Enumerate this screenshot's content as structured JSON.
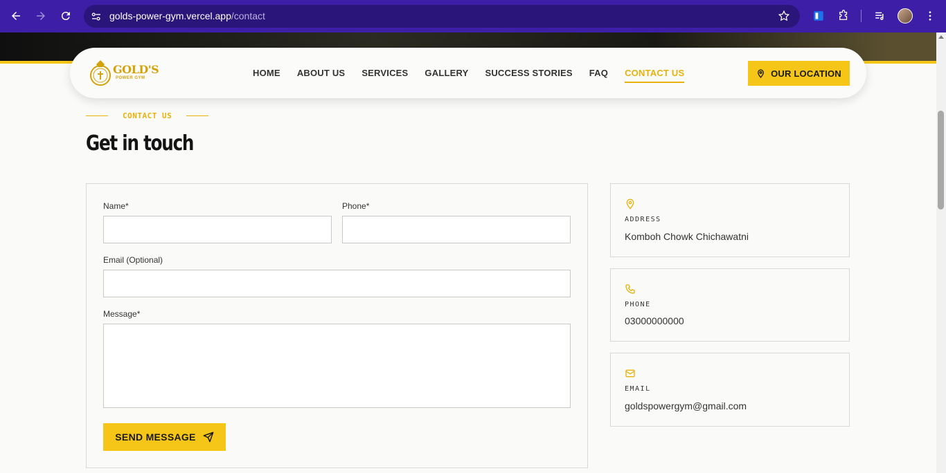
{
  "browser": {
    "url_host": "golds-power-gym.vercel.app",
    "url_path": "/contact"
  },
  "header": {
    "logo_text": "GOLD'S",
    "logo_subtext": "POWER GYM",
    "nav": [
      "HOME",
      "ABOUT US",
      "SERVICES",
      "GALLERY",
      "SUCCESS STORIES",
      "FAQ",
      "CONTACT US"
    ],
    "active_nav": "CONTACT US",
    "location_button": "OUR LOCATION"
  },
  "section": {
    "eyebrow": "CONTACT US",
    "title": "Get in touch"
  },
  "form": {
    "name_label": "Name*",
    "name_value": "",
    "phone_label": "Phone*",
    "phone_value": "",
    "email_label": "Email (Optional)",
    "email_value": "",
    "message_label": "Message*",
    "message_value": "",
    "send_button": "SEND MESSAGE"
  },
  "contact_info": {
    "address_label": "ADDRESS",
    "address_value": "Komboh Chowk Chichawatni",
    "phone_label": "PHONE",
    "phone_value": "03000000000",
    "email_label": "EMAIL",
    "email_value": "goldspowergym@gmail.com"
  },
  "colors": {
    "accent": "#f5c518",
    "chrome": "#3c1fa6"
  }
}
